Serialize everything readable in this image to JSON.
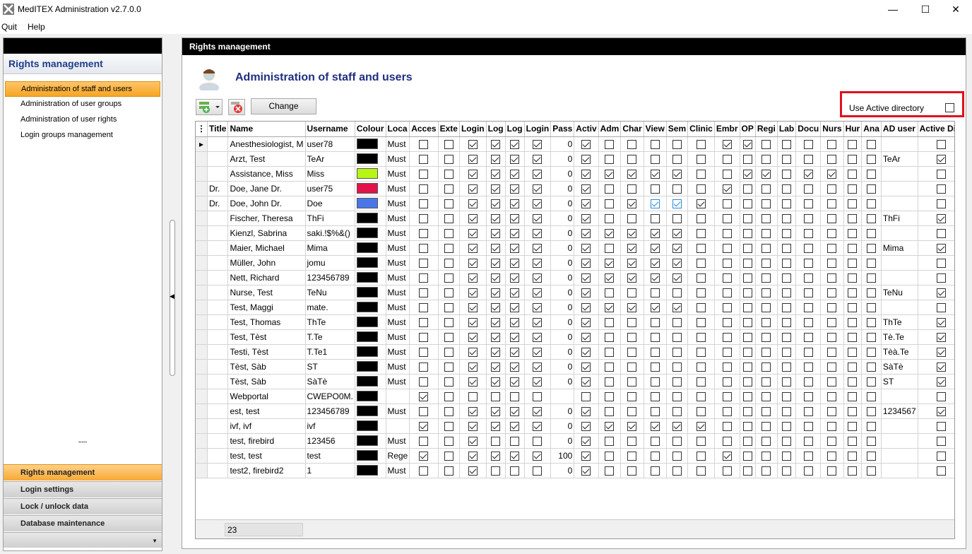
{
  "window": {
    "title": "MedITEX Administration v2.7.0.0"
  },
  "menu": [
    "Quit",
    "Help"
  ],
  "sidebar": {
    "header": "Rights management",
    "items": [
      {
        "label": "Administration of staff and users",
        "selected": true
      },
      {
        "label": "Administration of user groups",
        "selected": false
      },
      {
        "label": "Administration of user rights",
        "selected": false
      },
      {
        "label": "Login groups management",
        "selected": false
      }
    ],
    "sections": [
      {
        "label": "Rights management",
        "active": true
      },
      {
        "label": "Login settings",
        "active": false
      },
      {
        "label": "Lock / unlock data",
        "active": false
      },
      {
        "label": "Database maintenance",
        "active": false
      }
    ]
  },
  "main": {
    "header": "Rights management",
    "title": "Administration of staff and users",
    "change_label": "Change",
    "ad_label": "Use Active directory",
    "ad_checked": false,
    "row_count": "23"
  },
  "grid": {
    "columns": [
      "Title",
      "Name",
      "Username",
      "Colour",
      "Loca",
      "Acces",
      "Exte",
      "Login",
      "Log",
      "Log",
      "Login",
      "Pass",
      "Activ",
      "Adm",
      "Char",
      "View",
      "Sem",
      "Clinic",
      "Embr",
      "OP",
      "Regi",
      "Lab",
      "Docu",
      "Nurs",
      "Hur",
      "Ana",
      "AD user",
      "Active Dire"
    ],
    "rows": [
      {
        "title": "",
        "name": "Anesthesiologist, M",
        "user": "user78",
        "color": "#000000",
        "loc": "Must",
        "checks": [
          0,
          0,
          1,
          1,
          1,
          1
        ],
        "pass": "0",
        "rights": [
          1,
          0,
          0,
          0,
          0,
          0,
          1,
          1,
          0,
          0,
          0,
          0,
          0,
          0
        ],
        "ad": "",
        "adc": 0
      },
      {
        "title": "",
        "name": "Arzt, Test",
        "user": "TeAr",
        "color": "#000000",
        "loc": "Must",
        "checks": [
          0,
          0,
          1,
          1,
          1,
          1
        ],
        "pass": "0",
        "rights": [
          1,
          0,
          0,
          0,
          0,
          0,
          0,
          0,
          0,
          0,
          0,
          0,
          0,
          0
        ],
        "ad": "TeAr",
        "adc": 1
      },
      {
        "title": "",
        "name": "Assistance, Miss",
        "user": "Miss",
        "color": "#b6f514",
        "loc": "Must",
        "checks": [
          0,
          0,
          1,
          1,
          1,
          1
        ],
        "pass": "0",
        "rights": [
          1,
          1,
          1,
          1,
          1,
          0,
          0,
          1,
          1,
          0,
          1,
          1,
          0,
          0
        ],
        "ad": "",
        "adc": 0
      },
      {
        "title": "Dr.",
        "name": "Doe, Jane Dr.",
        "user": "user75",
        "color": "#e3134a",
        "loc": "Must",
        "checks": [
          0,
          0,
          1,
          1,
          1,
          1
        ],
        "pass": "0",
        "rights": [
          1,
          0,
          0,
          0,
          0,
          0,
          1,
          0,
          0,
          0,
          0,
          0,
          0,
          0
        ],
        "ad": "",
        "adc": 0
      },
      {
        "title": "Dr.",
        "name": "Doe, John Dr.",
        "user": "Doe",
        "color": "#4a77e8",
        "loc": "Must",
        "checks": [
          0,
          0,
          1,
          1,
          1,
          1
        ],
        "pass": "0",
        "rights": [
          1,
          0,
          1,
          1,
          1,
          1,
          0,
          0,
          0,
          0,
          0,
          0,
          0,
          0
        ],
        "ad": "",
        "adc": 0,
        "blue": true
      },
      {
        "title": "",
        "name": "Fischer, Theresa",
        "user": "ThFi",
        "color": "#000000",
        "loc": "Must",
        "checks": [
          0,
          0,
          1,
          1,
          1,
          1
        ],
        "pass": "0",
        "rights": [
          1,
          0,
          0,
          0,
          0,
          0,
          0,
          0,
          0,
          0,
          0,
          0,
          0,
          0
        ],
        "ad": "ThFi",
        "adc": 1
      },
      {
        "title": "",
        "name": "Kienzl, Sabrina",
        "user": "saki.!$%&()",
        "color": "#000000",
        "loc": "Must",
        "checks": [
          0,
          0,
          1,
          1,
          1,
          1
        ],
        "pass": "0",
        "rights": [
          1,
          1,
          1,
          1,
          1,
          0,
          0,
          0,
          0,
          0,
          0,
          0,
          0,
          0
        ],
        "ad": "",
        "adc": 0
      },
      {
        "title": "",
        "name": "Maier, Michael",
        "user": "Mima",
        "color": "#000000",
        "loc": "Must",
        "checks": [
          0,
          0,
          1,
          1,
          1,
          1
        ],
        "pass": "0",
        "rights": [
          1,
          0,
          1,
          1,
          1,
          0,
          0,
          0,
          0,
          0,
          0,
          0,
          0,
          0
        ],
        "ad": "Mima",
        "adc": 1
      },
      {
        "title": "",
        "name": "Müller, John",
        "user": "jomu",
        "color": "#000000",
        "loc": "Must",
        "checks": [
          0,
          0,
          1,
          1,
          1,
          1
        ],
        "pass": "0",
        "rights": [
          1,
          1,
          1,
          1,
          1,
          0,
          0,
          0,
          0,
          0,
          0,
          0,
          0,
          0
        ],
        "ad": "",
        "adc": 0
      },
      {
        "title": "",
        "name": "Nett, Richard",
        "user": "123456789",
        "color": "#000000",
        "loc": "Must",
        "checks": [
          0,
          0,
          1,
          1,
          1,
          1
        ],
        "pass": "0",
        "rights": [
          1,
          1,
          1,
          1,
          1,
          0,
          0,
          0,
          0,
          0,
          0,
          0,
          0,
          0
        ],
        "ad": "",
        "adc": 0
      },
      {
        "title": "",
        "name": "Nurse, Test",
        "user": "TeNu",
        "color": "#000000",
        "loc": "Must",
        "checks": [
          0,
          0,
          1,
          1,
          1,
          1
        ],
        "pass": "0",
        "rights": [
          1,
          0,
          0,
          0,
          0,
          0,
          0,
          0,
          0,
          0,
          0,
          0,
          0,
          0
        ],
        "ad": "TeNu",
        "adc": 1
      },
      {
        "title": "",
        "name": "Test, Maggi",
        "user": "mate.",
        "color": "#000000",
        "loc": "Must",
        "checks": [
          0,
          0,
          1,
          1,
          1,
          1
        ],
        "pass": "0",
        "rights": [
          1,
          1,
          1,
          1,
          1,
          0,
          0,
          0,
          0,
          0,
          0,
          0,
          0,
          0
        ],
        "ad": "",
        "adc": 0
      },
      {
        "title": "",
        "name": "Test, Thomas",
        "user": "ThTe",
        "color": "#000000",
        "loc": "Must",
        "checks": [
          0,
          0,
          1,
          1,
          1,
          1
        ],
        "pass": "0",
        "rights": [
          1,
          0,
          0,
          0,
          0,
          0,
          0,
          0,
          0,
          0,
          0,
          0,
          0,
          0
        ],
        "ad": "ThTe",
        "adc": 1
      },
      {
        "title": "",
        "name": "Test, Tèst",
        "user": "T.Te",
        "color": "#000000",
        "loc": "Must",
        "checks": [
          0,
          0,
          1,
          1,
          1,
          1
        ],
        "pass": "0",
        "rights": [
          1,
          0,
          0,
          0,
          0,
          0,
          0,
          0,
          0,
          0,
          0,
          0,
          0,
          0
        ],
        "ad": "Tè.Te",
        "adc": 1
      },
      {
        "title": "",
        "name": "Testi, Tèst",
        "user": "T.Te1",
        "color": "#000000",
        "loc": "Must",
        "checks": [
          0,
          0,
          1,
          1,
          1,
          1
        ],
        "pass": "0",
        "rights": [
          1,
          0,
          0,
          0,
          0,
          0,
          0,
          0,
          0,
          0,
          0,
          0,
          0,
          0
        ],
        "ad": "Tèà.Te",
        "adc": 1
      },
      {
        "title": "",
        "name": "Tèst, Sàb",
        "user": "ST",
        "color": "#000000",
        "loc": "Must",
        "checks": [
          0,
          0,
          1,
          1,
          1,
          1
        ],
        "pass": "0",
        "rights": [
          1,
          0,
          0,
          0,
          0,
          0,
          0,
          0,
          0,
          0,
          0,
          0,
          0,
          0
        ],
        "ad": "SàTè",
        "adc": 1
      },
      {
        "title": "",
        "name": "Tèst, Sàb",
        "user": "SàTè",
        "color": "#000000",
        "loc": "Must",
        "checks": [
          0,
          0,
          1,
          1,
          1,
          1
        ],
        "pass": "0",
        "rights": [
          1,
          0,
          0,
          0,
          0,
          0,
          0,
          0,
          0,
          0,
          0,
          0,
          0,
          0
        ],
        "ad": "ST",
        "adc": 1
      },
      {
        "title": "",
        "name": "Webportal",
        "user": "CWEPO0M.",
        "color": "#000000",
        "loc": "",
        "checks": [
          1,
          0,
          0,
          0,
          0,
          0
        ],
        "pass": "",
        "rights": [
          0,
          0,
          0,
          0,
          0,
          0,
          0,
          0,
          0,
          0,
          0,
          0,
          0,
          0
        ],
        "ad": "",
        "adc": 0
      },
      {
        "title": "",
        "name": "est, test",
        "user": "123456789",
        "color": "#000000",
        "loc": "Must",
        "checks": [
          0,
          0,
          1,
          1,
          1,
          1
        ],
        "pass": "0",
        "rights": [
          1,
          0,
          0,
          0,
          0,
          0,
          0,
          0,
          0,
          0,
          0,
          0,
          0,
          0
        ],
        "ad": "1234567",
        "adc": 1
      },
      {
        "title": "",
        "name": "ivf, ivf",
        "user": "ivf",
        "color": "#000000",
        "loc": "",
        "checks": [
          1,
          0,
          1,
          1,
          1,
          1
        ],
        "pass": "0",
        "rights": [
          1,
          1,
          1,
          1,
          1,
          1,
          0,
          0,
          0,
          0,
          0,
          0,
          0,
          0
        ],
        "ad": "",
        "adc": 0
      },
      {
        "title": "",
        "name": "test, firebird",
        "user": "123456",
        "color": "#000000",
        "loc": "Must",
        "checks": [
          0,
          0,
          1,
          0,
          0,
          0
        ],
        "pass": "0",
        "rights": [
          1,
          0,
          0,
          0,
          0,
          0,
          0,
          0,
          0,
          0,
          0,
          0,
          0,
          0
        ],
        "ad": "",
        "adc": 0
      },
      {
        "title": "",
        "name": "test, test",
        "user": "test",
        "color": "#000000",
        "loc": "Rege",
        "checks": [
          1,
          0,
          1,
          1,
          1,
          1
        ],
        "pass": "100",
        "rights": [
          1,
          0,
          0,
          0,
          0,
          0,
          1,
          0,
          0,
          0,
          0,
          0,
          0,
          0
        ],
        "ad": "",
        "adc": 0
      },
      {
        "title": "",
        "name": "test2, firebird2",
        "user": "1",
        "color": "#000000",
        "loc": "Must",
        "checks": [
          0,
          0,
          1,
          0,
          0,
          0
        ],
        "pass": "0",
        "rights": [
          1,
          0,
          0,
          0,
          0,
          0,
          0,
          0,
          0,
          0,
          0,
          0,
          0,
          0
        ],
        "ad": "",
        "adc": 0
      }
    ]
  }
}
